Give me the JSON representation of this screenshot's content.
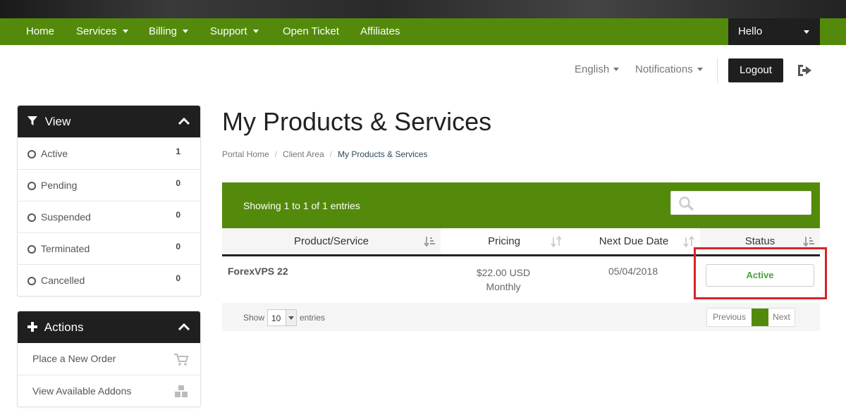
{
  "nav": {
    "items": [
      {
        "label": "Home",
        "dropdown": false
      },
      {
        "label": "Services",
        "dropdown": true
      },
      {
        "label": "Billing",
        "dropdown": true
      },
      {
        "label": "Support",
        "dropdown": true
      },
      {
        "label": "Open Ticket",
        "dropdown": false
      },
      {
        "label": "Affiliates",
        "dropdown": false
      }
    ],
    "account_label": "Hello"
  },
  "utility": {
    "language": "English",
    "notifications": "Notifications",
    "logout": "Logout",
    "exit_icon": "sign-out-icon"
  },
  "sidebar": {
    "view": {
      "title": "View",
      "icon": "filter-icon",
      "items": [
        {
          "label": "Active",
          "count": "1"
        },
        {
          "label": "Pending",
          "count": "0"
        },
        {
          "label": "Suspended",
          "count": "0"
        },
        {
          "label": "Terminated",
          "count": "0"
        },
        {
          "label": "Cancelled",
          "count": "0"
        }
      ]
    },
    "actions": {
      "title": "Actions",
      "icon": "plus-icon",
      "items": [
        {
          "label": "Place a New Order",
          "icon": "cart-icon"
        },
        {
          "label": "View Available Addons",
          "icon": "cubes-icon"
        }
      ]
    }
  },
  "main": {
    "title": "My Products & Services",
    "breadcrumb": [
      "Portal Home",
      "Client Area",
      "My Products & Services"
    ],
    "table": {
      "showing": "Showing 1 to 1 of 1 entries",
      "search_placeholder": "",
      "columns": [
        "Product/Service",
        "Pricing",
        "Next Due Date",
        "Status"
      ],
      "rows": [
        {
          "product": "ForexVPS 22",
          "price": "$22.00 USD",
          "cycle": "Monthly",
          "due": "05/04/2018",
          "status": "Active"
        }
      ],
      "footer": {
        "show": "Show",
        "length": "10",
        "entries": "entries",
        "previous": "Previous",
        "next": "Next"
      }
    }
  },
  "colors": {
    "brand_green": "#538a0b",
    "dark": "#1f1f1f",
    "status_active": "#48a23b",
    "highlight": "#d8232a"
  }
}
